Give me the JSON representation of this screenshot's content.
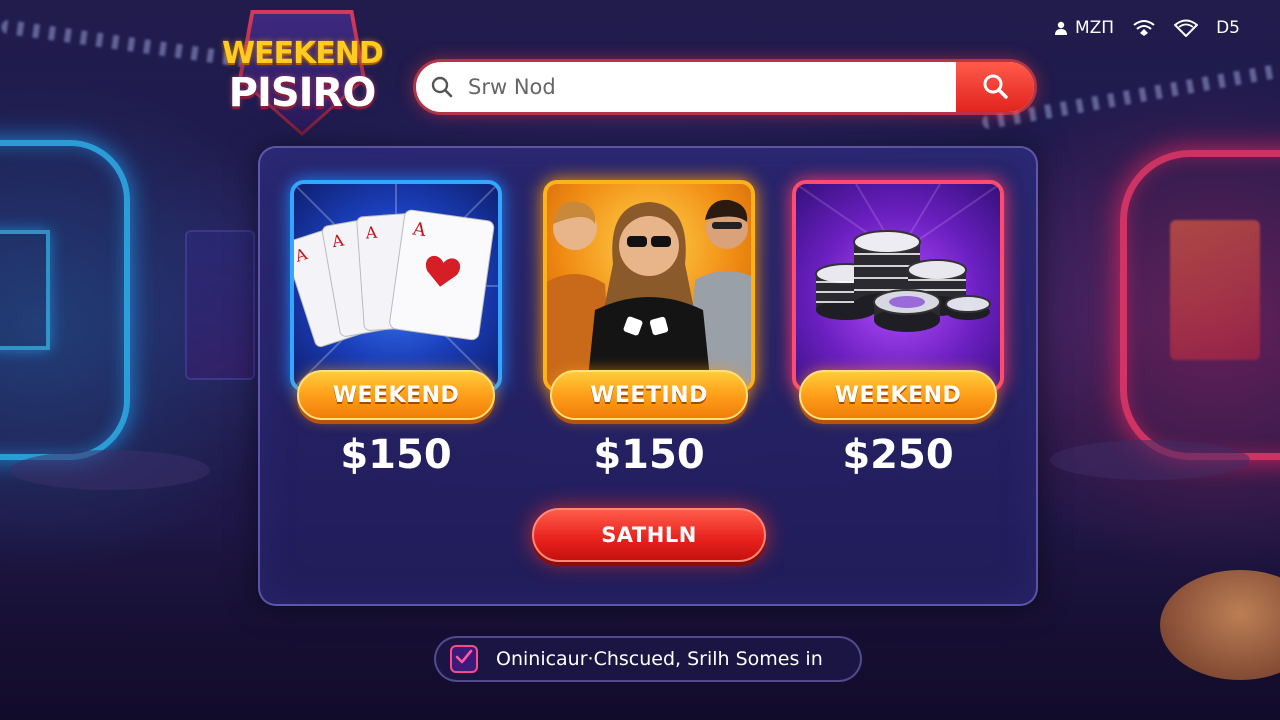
{
  "app": {
    "logo": {
      "line1": "WEEKEND",
      "line2": "PISIRO"
    }
  },
  "status_bar": {
    "account_icon": "person-icon",
    "account_label": "MZΠ",
    "signal_icon": "signal-icon",
    "wifi_icon": "wifi-icon",
    "battery_label": "D5"
  },
  "search": {
    "placeholder": "Srw Nod",
    "icon": "search-icon",
    "button_icon": "search-icon"
  },
  "cards": [
    {
      "art": "playing-cards-aces",
      "badge_label": "WEEKEND",
      "price": "$150",
      "border_color": "#33a6ff"
    },
    {
      "art": "group-of-players",
      "badge_label": "WEETIND",
      "price": "$150",
      "border_color": "#ffb31a"
    },
    {
      "art": "poker-chips-stack",
      "badge_label": "WEEKEND",
      "price": "$250",
      "border_color": "#ff4b6d"
    }
  ],
  "cta": {
    "label": "SATHLN"
  },
  "notice": {
    "checked": true,
    "text": "Oninicaur·Chscued, Srilh Somes in"
  },
  "colors": {
    "accent_red": "#e8201b",
    "badge_orange": "#ff9f1a",
    "panel": "#28266e"
  }
}
